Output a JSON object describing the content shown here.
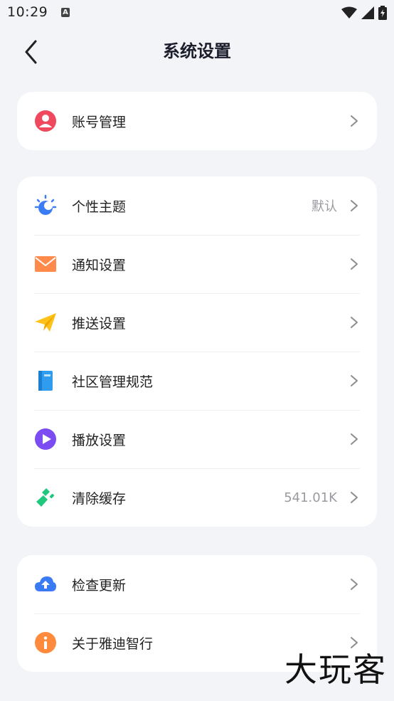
{
  "status_bar": {
    "time": "10:29",
    "notification_icon": "A"
  },
  "header": {
    "title": "系统设置"
  },
  "sections": [
    {
      "items": [
        {
          "label": "账号管理",
          "icon": "account-icon",
          "value": ""
        }
      ]
    },
    {
      "items": [
        {
          "label": "个性主题",
          "icon": "theme-icon",
          "value": "默认"
        },
        {
          "label": "通知设置",
          "icon": "mail-icon",
          "value": ""
        },
        {
          "label": "推送设置",
          "icon": "paper-plane-icon",
          "value": ""
        },
        {
          "label": "社区管理规范",
          "icon": "book-icon",
          "value": ""
        },
        {
          "label": "播放设置",
          "icon": "play-icon",
          "value": ""
        },
        {
          "label": "清除缓存",
          "icon": "broom-icon",
          "value": "541.01K"
        }
      ]
    },
    {
      "items": [
        {
          "label": "检查更新",
          "icon": "cloud-upload-icon",
          "value": ""
        },
        {
          "label": "关于雅迪智行",
          "icon": "info-icon",
          "value": ""
        }
      ]
    }
  ],
  "watermark": "大玩客",
  "colors": {
    "background": "#f3f4f8",
    "card": "#ffffff",
    "account": "#f0485d",
    "theme": "#3b7cf5",
    "mail": "#ff8a4c",
    "plane": "#ffc21a",
    "book": "#2f9cf0",
    "play": "#7a4cf2",
    "broom": "#1fc87d",
    "cloud": "#3a7af5",
    "info": "#ff8a3d"
  }
}
